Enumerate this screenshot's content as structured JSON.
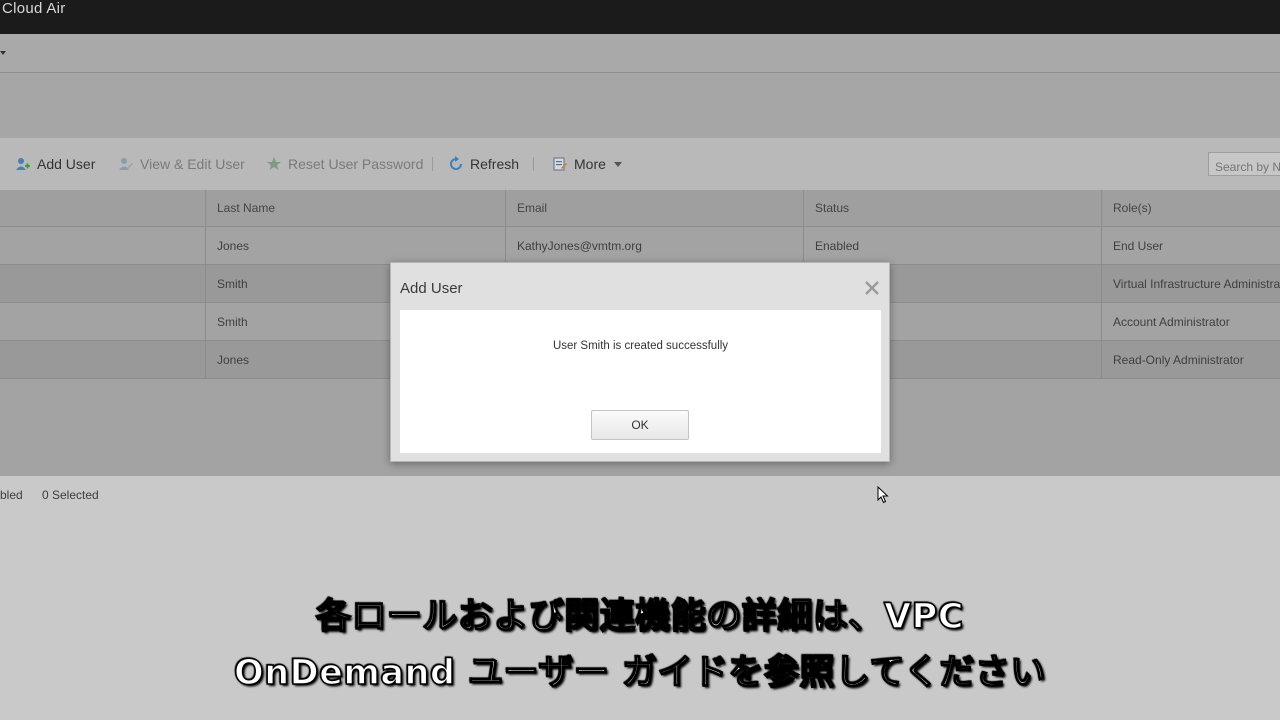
{
  "window": {
    "title": "Cloud Air"
  },
  "toolbar": {
    "add_user": "Add User",
    "view_edit_user": "View & Edit User",
    "reset_password": "Reset User Password",
    "refresh": "Refresh",
    "more": "More",
    "search_placeholder": "Search by Na"
  },
  "table": {
    "columns": [
      "Last Name",
      "Email",
      "Status",
      "Role(s)"
    ],
    "rows": [
      {
        "last_name": "Jones",
        "email": "KathyJones@vmtm.org",
        "status": "Enabled",
        "role": "End User"
      },
      {
        "last_name": "Smith",
        "email": "",
        "status": "",
        "role": "Virtual Infrastructure Administrat"
      },
      {
        "last_name": "Smith",
        "email": "",
        "status": "",
        "role": "Account Administrator"
      },
      {
        "last_name": "Jones",
        "email": "",
        "status": "",
        "role": "Read-Only Administrator"
      }
    ]
  },
  "footer": {
    "enabled_text": "bled",
    "selected_text": "0 Selected"
  },
  "dialog": {
    "title": "Add User",
    "message": "User Smith is created successfully",
    "ok_label": "OK"
  },
  "subtitles": {
    "line1": "各ロールおよび関連機能の詳細は、VPC",
    "line2": "OnDemand ユーザー ガイドを参照してください"
  }
}
